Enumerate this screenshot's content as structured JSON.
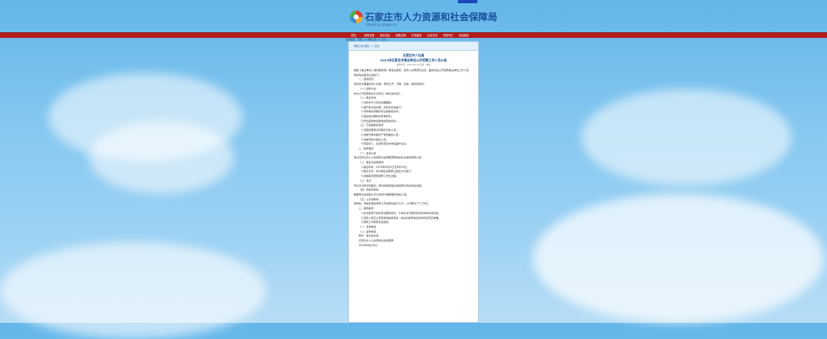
{
  "site": {
    "title": "石家庄市人力资源和社会保障局",
    "url": "http://rsj.sjz.gov.cn"
  },
  "nav": {
    "items": [
      "首页",
      "机构设置",
      "政务信息",
      "政策法规",
      "办事服务",
      "互动交流",
      "专题专栏",
      "在线服务",
      "公共服务",
      "网上办事"
    ]
  },
  "breadcrumb": "您的位置： 首页 >> 通知公告 >> 正文",
  "panel": {
    "header": "通知公告  首页 >> 正文",
    "title_line1": "石家庄市人社局",
    "title_line2": "2023年石家庄市事业单位公开招聘工作人员公告",
    "meta": "发布时间：2023-06-16  来源：本站",
    "paragraphs": [
      "根据《事业单位人事管理条例》等有关规定，经市人社局研究决定，面向社会公开招聘事业单位工作人员，",
      "现将有关事项公告如下。",
      "一、招聘原则",
      "坚持德才兼备的用人标准，贯彻公开、平等、竞争、择优的原则，",
      "（一）招聘计划",
      "本次公开招聘岗位计划详见《岗位信息表》。",
      "（二）报名条件",
      "1.具有中华人民共和国国籍；",
      "2.遵守宪法和法律，具有良好的品行；",
      "3.具有岗位所需的专业或技能条件；",
      "4.适应岗位要求的身体条件；",
      "5.符合招聘岗位要求的其他条件。",
      "（三）不得报考的情形",
      "1.曾因犯罪受过刑事处罚的人员；",
      "2.曾被开除中国共产党党籍的人员；",
      "3.曾被开除公职的人员；",
      "4.现役军人、在读普通高校非应届毕业生；",
      "二、招聘程序",
      "（一）发布公告",
      "通过石家庄市人力资源和社会保障局网站向社会发布招聘公告。",
      "（二）报名及资格审查",
      "1.报名时间：2023年6月20日至6月26日。",
      "2.报名方式：本次报名采取网上报名方式进行。",
      "3.资格审查贯穿招聘工作全过程。",
      "（三）考试",
      "考试分为笔试和面试，笔试成绩和面试成绩按比例合成总成绩。",
      "（四）体检和考察",
      "根据考试总成绩从高分到低分等额确定体检人选。",
      "（五）公示和聘用",
      "经体检、考察合格的拟聘人员在网站进行公示，公示期为7个工作日。",
      "三、其他事项",
      "1.本次招聘不指定考试辅导用书，不举办也不委托任何机构举办培训班。",
      "2.应聘人员应认真阅读诚信承诺书，提交的报考信息和材料应真实准确。",
      "3.招聘工作接受社会监督。",
      "（一）咨询电话",
      "（二）监督电话",
      "附件：岗位信息表",
      "石家庄市人力资源和社会保障局",
      "2023年6月16日"
    ]
  }
}
